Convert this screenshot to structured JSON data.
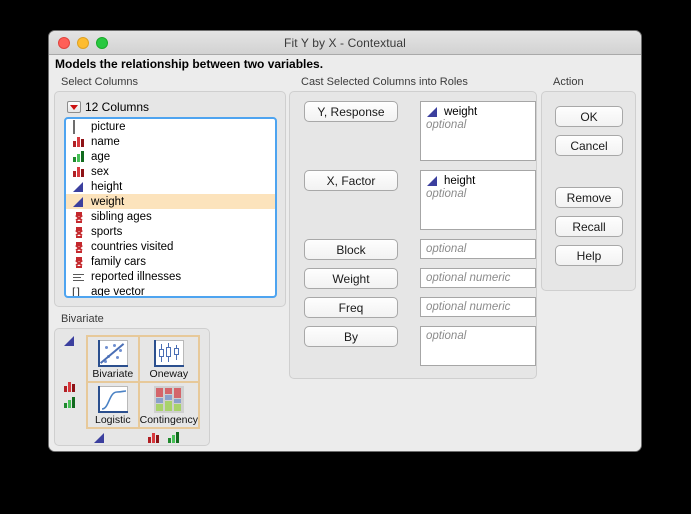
{
  "window": {
    "title": "Fit Y by X - Contextual",
    "subtitle": "Models the relationship between two variables.",
    "traffic": {
      "close": "close-button",
      "minimize": "minimize-button",
      "zoom": "zoom-button"
    }
  },
  "select_columns": {
    "group_label": "Select Columns",
    "columns_header": "12 Columns",
    "items": [
      {
        "label": "picture",
        "icon": "square-icon",
        "selected": false
      },
      {
        "label": "name",
        "icon": "nominal-red-bars-icon",
        "selected": false
      },
      {
        "label": "age",
        "icon": "ordinal-green-bars-icon",
        "selected": false
      },
      {
        "label": "sex",
        "icon": "nominal-red-bars-icon",
        "selected": false
      },
      {
        "label": "height",
        "icon": "continuous-blue-triangle-icon",
        "selected": false
      },
      {
        "label": "weight",
        "icon": "continuous-blue-triangle-icon",
        "selected": true
      },
      {
        "label": "sibling ages",
        "icon": "nominal-x-icon",
        "selected": false
      },
      {
        "label": "sports",
        "icon": "nominal-x-icon",
        "selected": false
      },
      {
        "label": "countries visited",
        "icon": "nominal-x-icon",
        "selected": false
      },
      {
        "label": "family cars",
        "icon": "nominal-x-icon",
        "selected": false
      },
      {
        "label": "reported illnesses",
        "icon": "multiple-response-lines-icon",
        "selected": false
      },
      {
        "label": "age vector",
        "icon": "vector-brackets-icon",
        "selected": false
      }
    ],
    "selection_color": "#fce3bc",
    "focus_border_color": "#4ea4f0"
  },
  "bivariate": {
    "group_label": "Bivariate",
    "cells": [
      {
        "label": "Bivariate",
        "icon": "scatterplot-icon"
      },
      {
        "label": "Oneway",
        "icon": "boxplot-icon"
      },
      {
        "label": "Logistic",
        "icon": "logistic-curve-icon"
      },
      {
        "label": "Contingency",
        "icon": "mosaic-plot-icon"
      }
    ],
    "row_glyphs": [
      {
        "icon": "continuous-blue-triangle-icon"
      },
      {
        "icon": "nominal-red-bars-icon"
      },
      {
        "icon": "ordinal-green-bars-icon"
      }
    ],
    "col_glyphs": [
      {
        "icon": "continuous-blue-triangle-icon"
      },
      {
        "icon": "nominal-red-bars-icon"
      },
      {
        "icon": "ordinal-green-bars-icon"
      }
    ],
    "grid_color": "#e7c99a"
  },
  "cast_roles": {
    "group_label": "Cast Selected Columns into Roles",
    "roles": [
      {
        "button": "Y, Response",
        "value": "weight",
        "value_icon": "continuous-blue-triangle-icon",
        "placeholder": "optional",
        "tall": true
      },
      {
        "button": "X, Factor",
        "value": "height",
        "value_icon": "continuous-blue-triangle-icon",
        "placeholder": "optional",
        "tall": true
      },
      {
        "button": "Block",
        "value": "",
        "value_icon": "",
        "placeholder": "optional",
        "tall": false
      },
      {
        "button": "Weight",
        "value": "",
        "value_icon": "",
        "placeholder": "optional numeric",
        "tall": false
      },
      {
        "button": "Freq",
        "value": "",
        "value_icon": "",
        "placeholder": "optional numeric",
        "tall": false
      },
      {
        "button": "By",
        "value": "",
        "value_icon": "",
        "placeholder": "optional",
        "tall": "medium"
      }
    ]
  },
  "action": {
    "group_label": "Action",
    "buttons": [
      {
        "label": "OK"
      },
      {
        "label": "Cancel"
      },
      {
        "label": "Remove"
      },
      {
        "label": "Recall"
      },
      {
        "label": "Help"
      }
    ]
  }
}
